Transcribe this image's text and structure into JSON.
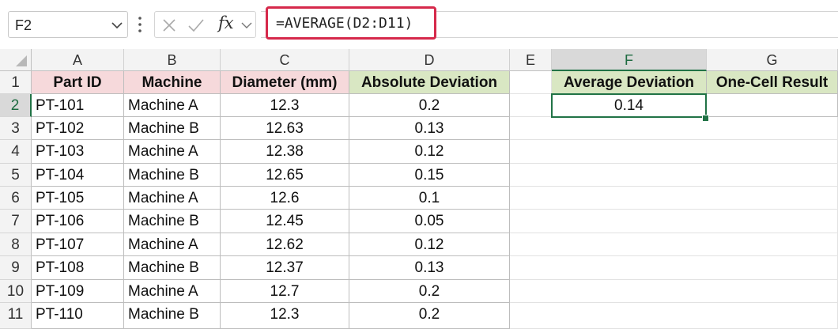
{
  "formula_bar": {
    "name_box": "F2",
    "formula": "=AVERAGE(D2:D11)",
    "fx_label": "fx"
  },
  "columns": [
    "A",
    "B",
    "C",
    "D",
    "E",
    "F",
    "G"
  ],
  "selected_column": "F",
  "selected_row": "2",
  "row_numbers": [
    "1",
    "2",
    "3",
    "4",
    "5",
    "6",
    "7",
    "8",
    "9",
    "10",
    "11"
  ],
  "headers": {
    "part_id": "Part ID",
    "machine": "Machine",
    "diameter": "Diameter (mm)",
    "abs_dev": "Absolute Deviation",
    "avg_dev": "Average Deviation",
    "one_cell": "One-Cell Result"
  },
  "rows": [
    {
      "id": "PT-101",
      "machine": "Machine A",
      "diameter": "12.3",
      "dev": "0.2"
    },
    {
      "id": "PT-102",
      "machine": "Machine B",
      "diameter": "12.63",
      "dev": "0.13"
    },
    {
      "id": "PT-103",
      "machine": "Machine A",
      "diameter": "12.38",
      "dev": "0.12"
    },
    {
      "id": "PT-104",
      "machine": "Machine B",
      "diameter": "12.65",
      "dev": "0.15"
    },
    {
      "id": "PT-105",
      "machine": "Machine A",
      "diameter": "12.6",
      "dev": "0.1"
    },
    {
      "id": "PT-106",
      "machine": "Machine B",
      "diameter": "12.45",
      "dev": "0.05"
    },
    {
      "id": "PT-107",
      "machine": "Machine A",
      "diameter": "12.62",
      "dev": "0.12"
    },
    {
      "id": "PT-108",
      "machine": "Machine B",
      "diameter": "12.37",
      "dev": "0.13"
    },
    {
      "id": "PT-109",
      "machine": "Machine A",
      "diameter": "12.7",
      "dev": "0.2"
    },
    {
      "id": "PT-110",
      "machine": "Machine B",
      "diameter": "12.3",
      "dev": "0.2"
    }
  ],
  "results": {
    "avg_dev_value": "0.14",
    "one_cell_value": ""
  },
  "colors": {
    "selection": "#217346",
    "highlight_border": "#d6294b",
    "pink_header": "#f6d9db",
    "green_header": "#d9e7c3"
  }
}
